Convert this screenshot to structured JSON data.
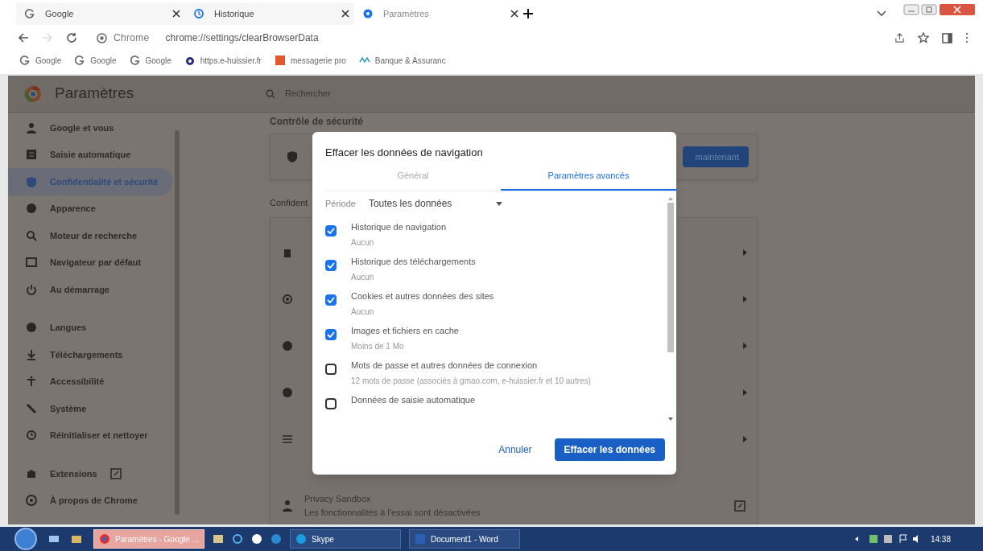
{
  "browser": {
    "tabs": [
      {
        "label": "Google",
        "selected": false
      },
      {
        "label": "Historique",
        "selected": false
      },
      {
        "label": "Paramètres",
        "selected": true
      }
    ],
    "address": {
      "site_label": "Chrome",
      "url": "chrome://settings/clearBrowserData"
    },
    "bookmarks": [
      "Google",
      "Google",
      "Google",
      "https.e-huissier.fr",
      "messagerie pro",
      "Banque & Assuranc"
    ]
  },
  "settings": {
    "title": "Paramètres",
    "search": {
      "placeholder": "Rechercher"
    },
    "sidebar": {
      "items": [
        {
          "label": "Google et vous",
          "selected": false
        },
        {
          "label": "Saisie automatique",
          "selected": false
        },
        {
          "label": "Confidentialité et sécurité",
          "selected": true
        },
        {
          "label": "Apparence",
          "selected": false
        },
        {
          "label": "Moteur de recherche",
          "selected": false
        },
        {
          "label": "Navigateur par défaut",
          "selected": false
        },
        {
          "label": "Au démarrage",
          "selected": false
        },
        {
          "label": "Langues",
          "selected": false
        },
        {
          "label": "Téléchargements",
          "selected": false
        },
        {
          "label": "Accessibilité",
          "selected": false
        },
        {
          "label": "Système",
          "selected": false
        },
        {
          "label": "Réinitialiser et nettoyer",
          "selected": false
        },
        {
          "label": "Extensions",
          "selected": false
        },
        {
          "label": "À propos de Chrome",
          "selected": false
        }
      ]
    },
    "main": {
      "safety_heading": "Contrôle de sécurité",
      "safety_button": "maintenant",
      "privacy_heading": "Confident",
      "privacy_sandbox": {
        "title": "Privacy Sandbox",
        "subtitle": "Les fonctionnalités à l'essai sont désactivées"
      }
    }
  },
  "dialog": {
    "title": "Effacer les données de navigation",
    "tabs": [
      {
        "label": "Général",
        "selected": false
      },
      {
        "label": "Paramètres avancés",
        "selected": true
      }
    ],
    "period": {
      "label": "Période",
      "value": "Toutes les données"
    },
    "items": [
      {
        "label": "Historique de navigation",
        "detail": "Aucun",
        "checked": true
      },
      {
        "label": "Historique des téléchargements",
        "detail": "Aucun",
        "checked": true
      },
      {
        "label": "Cookies et autres données des sites",
        "detail": "Aucun",
        "checked": true
      },
      {
        "label": "Images et fichiers en cache",
        "detail": "Moins de 1 Mo",
        "checked": true
      },
      {
        "label": "Mots de passe et autres données de connexion",
        "detail": "12 mots de passe (associés à gmao.com, e-huissier.fr et 10 autres)",
        "checked": false
      },
      {
        "label": "Données de saisie automatique",
        "checked": false
      }
    ],
    "buttons": {
      "cancel": "Annuler",
      "confirm": "Effacer les données"
    }
  },
  "taskbar": {
    "items": [
      {
        "label": "Paramètres - Google ...",
        "selected": true
      },
      {
        "label": "Skype",
        "selected": false
      },
      {
        "label": "Document1 - Word",
        "selected": false
      }
    ],
    "clock": "14:38"
  }
}
